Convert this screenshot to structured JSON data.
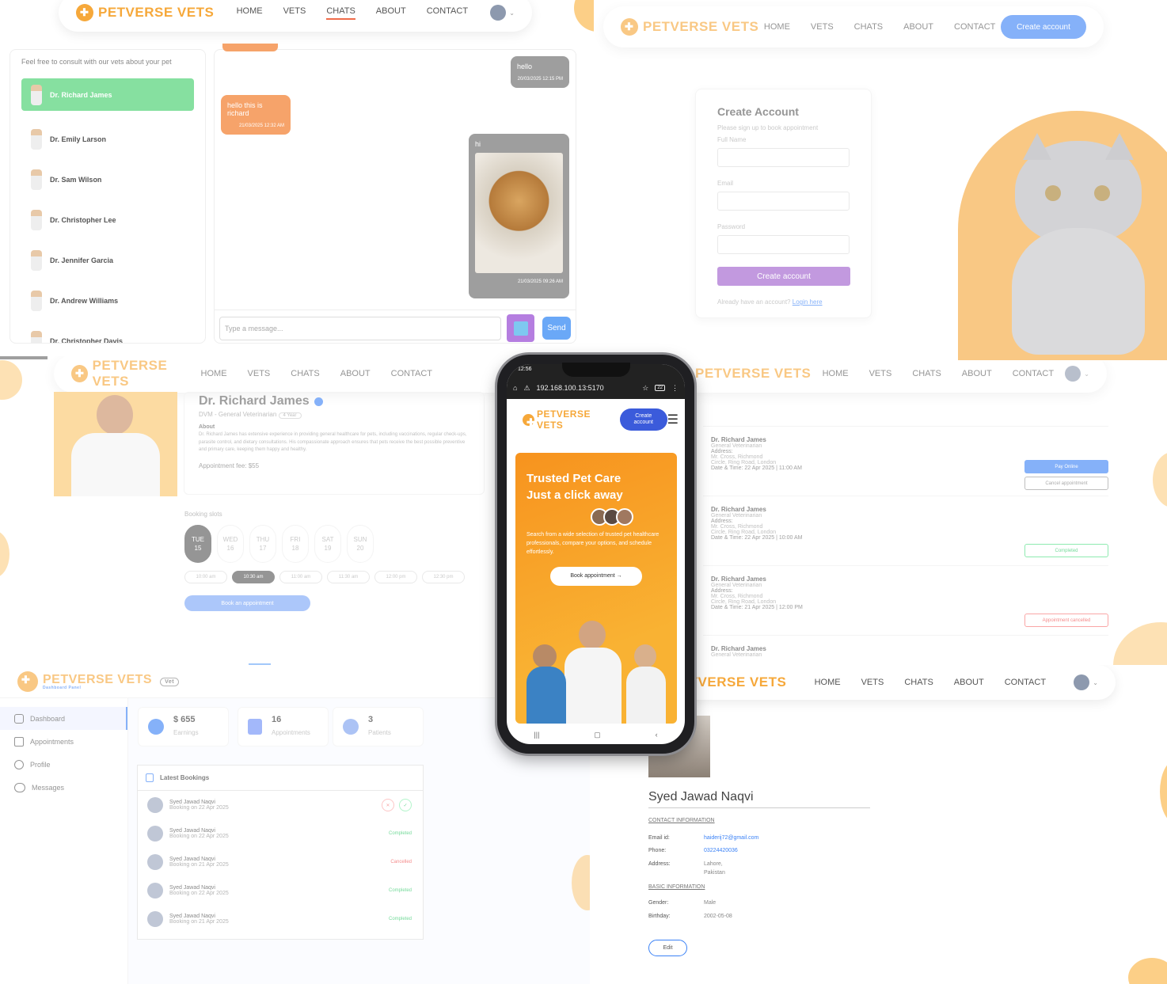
{
  "brand": "PETVERSE VETS",
  "nav": [
    "HOME",
    "VETS",
    "CHATS",
    "ABOUT",
    "CONTACT"
  ],
  "chat": {
    "intro": "Feel free to consult with our vets about your pet",
    "vets": [
      "Dr. Richard James",
      "Dr. Emily Larson",
      "Dr. Sam Wilson",
      "Dr. Christopher Lee",
      "Dr. Jennifer Garcia",
      "Dr. Andrew Williams",
      "Dr. Christopher Davis"
    ],
    "messages": [
      {
        "text": "hello",
        "time": "20/03/2025 12:15 PM"
      },
      {
        "text": "hello this is richard",
        "time": "21/03/2025 12:32 AM"
      },
      {
        "text": "hi",
        "time": "21/03/2025 09:26 AM"
      }
    ],
    "placeholder": "Type a message...",
    "send": "Send"
  },
  "signup": {
    "create_btn_nav": "Create account",
    "title": "Create Account",
    "subtitle": "Please sign up to book appointment",
    "full_name": "Full Name",
    "email": "Email",
    "password": "Password",
    "submit": "Create account",
    "login_prompt": "Already have an account?",
    "login_link": "Login here"
  },
  "vet_profile": {
    "name": "Dr. Richard James",
    "degree": "DVM - General Veterinarian",
    "exp": "4 Year",
    "about_label": "About",
    "about": "Dr. Richard James has extensive experience in providing general healthcare for pets, including vaccinations, regular check-ups, parasite control, and dietary consultations. His compassionate approach ensures that pets receive the best possible preventive and primary care, keeping them happy and healthy.",
    "fee": "Appointment fee: $55",
    "slots_label": "Booking slots",
    "days": [
      {
        "d": "TUE",
        "n": "15"
      },
      {
        "d": "WED",
        "n": "16"
      },
      {
        "d": "THU",
        "n": "17"
      },
      {
        "d": "FRI",
        "n": "18"
      },
      {
        "d": "SAT",
        "n": "19"
      },
      {
        "d": "SUN",
        "n": "20"
      }
    ],
    "times": [
      "10:00 am",
      "10:30 am",
      "11:00 am",
      "11:30 am",
      "12:00 pm",
      "12:30 pm"
    ],
    "book": "Book an appointment"
  },
  "phone": {
    "time": "12:56",
    "url": "192.168.100.13:5170",
    "create": "Create account",
    "hero_line1": "Trusted Pet Care",
    "hero_line2": "Just a click away",
    "hero_text": "Search from a wide selection of trusted pet healthcare professionals, compare your options, and schedule effortlessly.",
    "cta": "Book appointment →"
  },
  "appointments": {
    "items": [
      {
        "name": "Dr. Richard James",
        "spec": "General Veterinarian",
        "address_label": "Address:",
        "addr1": "Mr. Cross, Richmond",
        "addr2": "Circle, Ring Road, London",
        "datetime": "Date & Time: 22 Apr 2025 | 11:00 AM",
        "status": "Pay Online",
        "status2": "Cancel appointment"
      },
      {
        "name": "Dr. Richard James",
        "spec": "General Veterinarian",
        "address_label": "Address:",
        "addr1": "Mr. Cross, Richmond",
        "addr2": "Circle, Ring Road, London",
        "datetime": "Date & Time: 22 Apr 2025 | 10:00 AM",
        "status": "Completed"
      },
      {
        "name": "Dr. Richard James",
        "spec": "General Veterinarian",
        "address_label": "Address:",
        "addr1": "Mr. Cross, Richmond",
        "addr2": "Circle, Ring Road, London",
        "datetime": "Date & Time: 21 Apr 2025 | 12:00 PM",
        "status": "Appointment cancelled"
      },
      {
        "name": "Dr. Richard James",
        "spec": "General Veterinarian"
      }
    ]
  },
  "dashboard": {
    "sub": "Dashboard Panel",
    "badge": "Vet",
    "menu": [
      "Dashboard",
      "Appointments",
      "Profile",
      "Messages"
    ],
    "stats": [
      {
        "value": "$ 655",
        "label": "Earnings"
      },
      {
        "value": "16",
        "label": "Appointments"
      },
      {
        "value": "3",
        "label": "Patients"
      }
    ],
    "latest": "Latest Bookings",
    "bookings": [
      {
        "name": "Syed Jawad Naqvi",
        "date": "Booking on 22 Apr 2025",
        "status": ""
      },
      {
        "name": "Syed Jawad Naqvi",
        "date": "Booking on 22 Apr 2025",
        "status": "Completed"
      },
      {
        "name": "Syed Jawad Naqvi",
        "date": "Booking on 21 Apr 2025",
        "status": "Cancelled"
      },
      {
        "name": "Syed Jawad Naqvi",
        "date": "Booking on 22 Apr 2025",
        "status": "Completed"
      },
      {
        "name": "Syed Jawad Naqvi",
        "date": "Booking on 21 Apr 2025",
        "status": "Completed"
      }
    ]
  },
  "user_profile": {
    "name": "Syed Jawad Naqvi",
    "contact_hdr": "CONTACT INFORMATION",
    "email_label": "Email id:",
    "email": "haiderij72@gmail.com",
    "phone_label": "Phone:",
    "phone": "03224420036",
    "address_label": "Address:",
    "address1": "Lahore,",
    "address2": "Pakistan",
    "basic_hdr": "BASIC INFORMATION",
    "gender_label": "Gender:",
    "gender": "Male",
    "birthday_label": "Birthday:",
    "birthday": "2002-05-08",
    "edit": "Edit"
  },
  "colors": {
    "orange": "#f6a83a",
    "blue": "#3b82f6",
    "green": "#86e0a0",
    "purple": "#b57ee0"
  }
}
